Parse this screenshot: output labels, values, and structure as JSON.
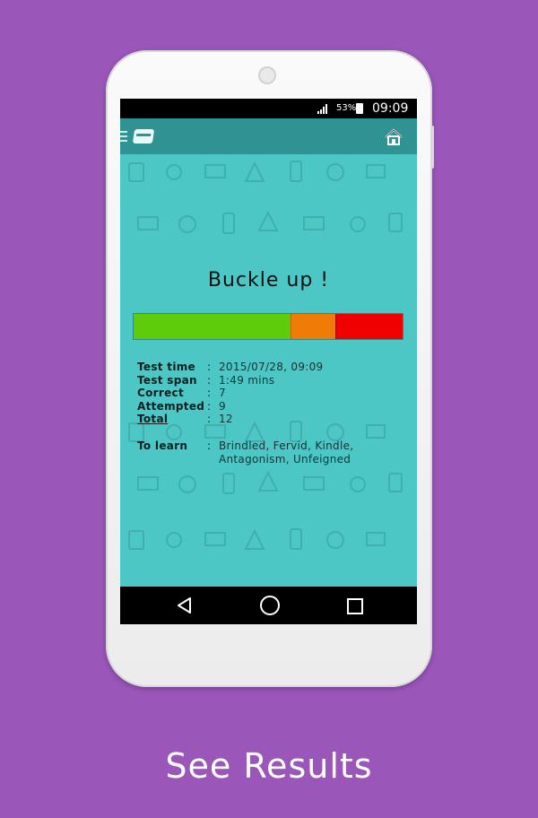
{
  "status_bar": {
    "battery": "53%",
    "time": "09:09"
  },
  "app_bar": {
    "hamburger_icon": "hamburger-icon",
    "logo_icon": "card-icon",
    "home_icon": "home-icon"
  },
  "result": {
    "headline": "Buckle up !",
    "progress": {
      "correct": 7,
      "attempted": 9,
      "total": 12,
      "colors": {
        "correct": "#5fcc0b",
        "attempted": "#ef7c06",
        "remaining": "#f10000"
      }
    },
    "stats": [
      {
        "label": "Test time",
        "colon": ":",
        "value": "2015/07/28, 09:09"
      },
      {
        "label": "Test span",
        "colon": ":",
        "value": "1:49 mins"
      },
      {
        "label": "Correct",
        "colon": ":",
        "value": "7"
      },
      {
        "label": "Attempted",
        "colon": ":",
        "value": "9"
      },
      {
        "label": "Total",
        "colon": ":",
        "value": "12"
      }
    ],
    "to_learn": {
      "label": "To learn",
      "colon": ":",
      "value": "Brindled, Fervid, Kindle, Antagonism, Unfeigned"
    }
  },
  "nav_bar": {
    "back_icon": "back-triangle-icon",
    "home_icon": "home-circle-icon",
    "recent_icon": "recent-square-icon"
  },
  "caption": "See Results"
}
